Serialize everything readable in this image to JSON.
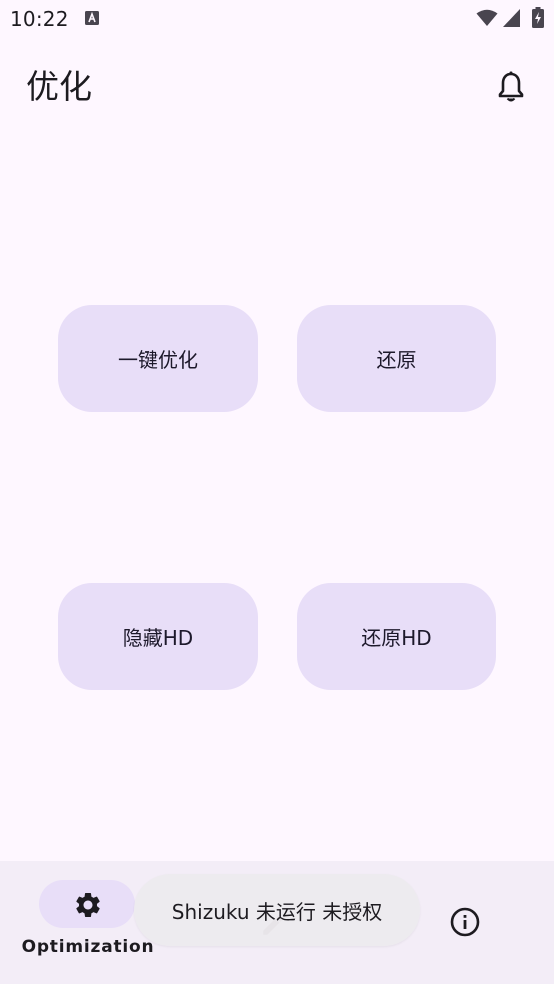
{
  "status_bar": {
    "time": "10:22",
    "notification_icon": "a-icon",
    "wifi_icon": "wifi-icon",
    "signal_icon": "signal-icon",
    "battery_icon": "battery-charging-icon"
  },
  "header": {
    "title": "优化",
    "action_icon": "bell-icon"
  },
  "actions": [
    {
      "label": "一键优化"
    },
    {
      "label": "还原"
    },
    {
      "label": "隐藏HD"
    },
    {
      "label": "还原HD"
    }
  ],
  "bottom_nav": {
    "items": [
      {
        "label": "Optimization",
        "icon": "gear-icon",
        "selected": true
      },
      {
        "label": "",
        "icon": "pencil-icon",
        "selected": false
      },
      {
        "label": "",
        "icon": "info-icon",
        "selected": false
      }
    ]
  },
  "toast": {
    "text": "Shizuku 未运行 未授权"
  },
  "colors": {
    "background": "#FEF7FF",
    "button_container": "#E8DEF8",
    "nav_background": "#F3EDF7",
    "text": "#1D1B20"
  }
}
